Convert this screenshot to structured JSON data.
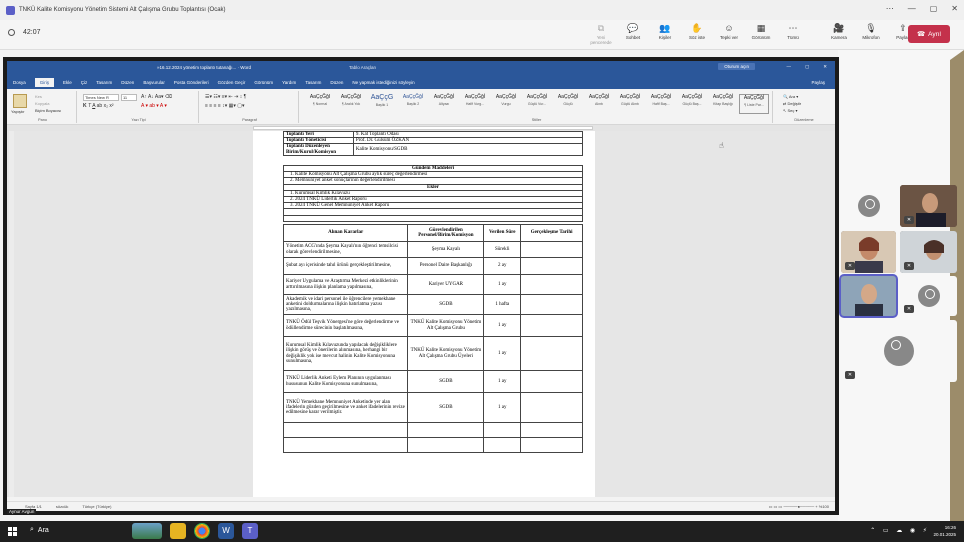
{
  "teams": {
    "window_title": "TNKÜ Kalite Komisyonu Yönetim Sistemi Alt Çalışma Grubu Toplantısı (Ocak)",
    "timer": "42:07",
    "tools": [
      {
        "label": "Yeni pencerede",
        "icon": "new-window-icon",
        "dim": true
      },
      {
        "label": "Sohbet",
        "icon": "chat-icon"
      },
      {
        "label": "Kişiler",
        "icon": "people-icon"
      },
      {
        "label": "Söz iste",
        "icon": "raise-hand-icon"
      },
      {
        "label": "Tepki ver",
        "icon": "reaction-icon"
      },
      {
        "label": "Görünüm",
        "icon": "view-icon"
      },
      {
        "label": "Tümü",
        "icon": "more-icon"
      },
      {
        "label": "Kamera",
        "icon": "camera-off-icon"
      },
      {
        "label": "Mikrofon",
        "icon": "mic-off-icon"
      },
      {
        "label": "Paylaş",
        "icon": "share-icon"
      }
    ],
    "leave_label": "Ayrıl"
  },
  "word": {
    "file_name": "»16.12.2024 yönetim toplantı tutanağı... · Word",
    "table_tools": "Tablo Araçları",
    "sign_in": "Oturum açın",
    "tabs": [
      "Dosya",
      "Giriş",
      "Ekle",
      "Çiz",
      "Tasarım",
      "Düzen",
      "Başvurular",
      "Posta Gönderileri",
      "Gözden Geçir",
      "Görünüm",
      "Yardım",
      "Tasarım",
      "Düzen",
      "Ne yapmak istediğinizi söyleyin"
    ],
    "share_tab": "Paylaş",
    "clipboard": {
      "paste": "Yapıştır",
      "cut": "Kes",
      "copy": "Kopyala",
      "format_painter": "Biçim Boyacısı",
      "label": "Pano"
    },
    "font": {
      "name": "Times New R",
      "size": "11",
      "label": "Yazı Tipi"
    },
    "paragraph_label": "Paragraf",
    "styles": [
      {
        "sample": "AaÇçĞğI",
        "name": "¶ Normal"
      },
      {
        "sample": "AaÇçĞğI",
        "name": "¶ Aralık Yok"
      },
      {
        "sample": "AaÇçG",
        "name": "Başlık 1"
      },
      {
        "sample": "AaÇçĞğİ",
        "name": "Başlık 2"
      },
      {
        "sample": "AaÇçĞğİ",
        "name": "Altyazı"
      },
      {
        "sample": "AaÇçĞğİ",
        "name": "Hafif Vurg..."
      },
      {
        "sample": "AaÇçĞğİ",
        "name": "Vurgu"
      },
      {
        "sample": "AaÇçĞğİ",
        "name": "Güçlü Vur..."
      },
      {
        "sample": "AaÇçĞğİ",
        "name": "Güçlü"
      },
      {
        "sample": "AaÇçĞğİ",
        "name": "Alıntı"
      },
      {
        "sample": "AaÇçĞğİ",
        "name": "Güçlü Alıntı"
      },
      {
        "sample": "AaÇçĞğİ",
        "name": "Hafif Baş..."
      },
      {
        "sample": "AaÇçĞğİ",
        "name": "Güçlü Baş..."
      },
      {
        "sample": "AaÇçĞğİ",
        "name": "Kitap Başlığı"
      },
      {
        "sample": "AaÇçĞğİ",
        "name": "¶ Liste Par..."
      }
    ],
    "styles_label": "Stiller",
    "editing": {
      "find": "Ara",
      "replace": "Değiştir",
      "select": "Seç",
      "label": "Düzenleme"
    },
    "status": {
      "page": "Sayfa 1/1",
      "words": "sözcük",
      "lang": "Türkçe (Türkiye)",
      "zoom": "%100"
    }
  },
  "doc": {
    "info_rows": [
      {
        "k": "Toplantı Yeri",
        "v": "9. Kat Toplantı Odası"
      },
      {
        "k": "Toplantı Yöneticisi",
        "v": "Prof. Dr. Gülsüm ÖZKAN"
      },
      {
        "k": "Toplantı Düzenleyen Birim/Kurul/Komisyon",
        "v": "Kalite Komisyonu/SGDB"
      }
    ],
    "agenda_title": "Gündem Maddeleri",
    "agenda": [
      "1.   Kalite Komisyonu Alt Çalışma Grubu aylık süreç değerlendirmesi",
      "2.   Memnuniyet anket sonuçlarının değerlendirilmesi"
    ],
    "attachments_title": "Ekler",
    "attachments": [
      "1.   Kurumsal Kimlik Kılavuzu",
      "2.   2024 TNKÜ Liderlik Anket Raporu",
      "3.   2024 TNKÜ Genel Memnuniyet Anket Raporu"
    ],
    "decisions_headers": [
      "Alınan Kararlar",
      "Görevlendirilen Personel/Birim/Komisyon",
      "Verilen Süre",
      "Gerçekleşme Tarihi"
    ],
    "decisions": [
      {
        "karar": "Yönetim ACG'ında Şeyma Kayalı'nın öğrenci temsilcisi olarak görevlendirilmesine,",
        "gorevli": "Şeyma Kayalı",
        "sure": "Sürekli"
      },
      {
        "karar": "Şubat ayı içerisinde tahıl ürünü gerçekleştirilmesine,",
        "gorevli": "Personel Daire Başkanlığı",
        "sure": "2 ay"
      },
      {
        "karar": "Kariyer Uygulama ve Araştırma Merkezi etkinliklerinin arttırılmasına ilişkin planlama yapılmasına,",
        "gorevli": "Kariyer UYGAR",
        "sure": "1 ay"
      },
      {
        "karar": "Akademik ve idari personel ile öğrencilere yemekhane anketini doldurmalarına ilişkin hatırlatma yazısı yazılmasına,",
        "gorevli": "SGDB",
        "sure": "1 hafta"
      },
      {
        "karar": "TNKÜ Ödül Teşvik Yönergesi'ne göre değerlendirme ve ödüllendirme sürecinin başlatılmasına,",
        "gorevli": "TNKÜ Kalite Komisyonu Yönetim Alt Çalışma Grubu",
        "sure": "1 ay"
      },
      {
        "karar": "Kurumsal Kimlik Kılavuzunda yapılacak değişikliklere ilişkin görüş ve önerilerin alınmasına, herhangi bir değişiklik yok ise mevcut halinin Kalite Komisyonuna sunulmasına,",
        "gorevli": "TNKÜ Kalite Komisyonu Yönetim Alt Çalışma Grubu Üyeleri",
        "sure": "1 ay"
      },
      {
        "karar": "TNKÜ Liderlik Anketi Eylem Planının uygulanması hususunun Kalite Komisyonuna sunulmasına,",
        "gorevli": "SGDB",
        "sure": "1 ay"
      },
      {
        "karar": "TNKÜ Yemekhane Memnuniyet Anketinde yer alan ifadelerin gözden geçirilmesine ve anket ifadelerinin revize edilmesine karar verilmiştir.",
        "gorevli": "SGDB",
        "sure": "1 ay"
      }
    ]
  },
  "presenter_name": "Aynur Avgun",
  "taskbar": {
    "search": "Ara",
    "time": "16:26",
    "date": "20.01.2025"
  }
}
